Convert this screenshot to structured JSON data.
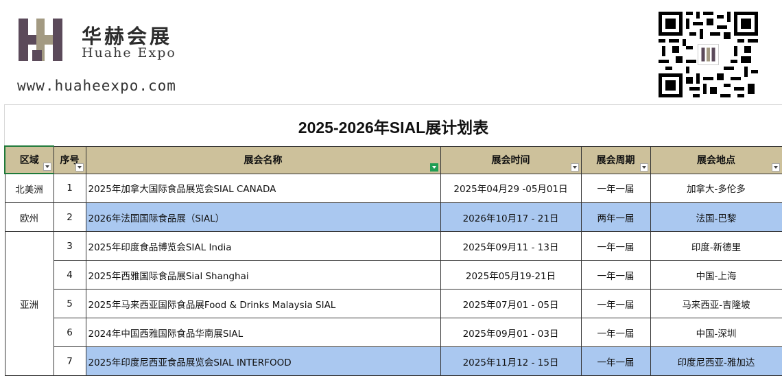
{
  "header": {
    "brand_cn": "华赫会展",
    "brand_en": "Huahe Expo",
    "website": "www.huaheexpo.com",
    "logo_color": "#5b4a5a",
    "logo_accent": "#a39a82"
  },
  "title": "2025-2026年SIAL展计划表",
  "table": {
    "columns": [
      "区域",
      "序号",
      "展会名称",
      "展会时间",
      "展会周期",
      "展会地点"
    ],
    "rows": [
      {
        "no": "1",
        "name": "2025年加拿大国际食品展览会SIAL CANADA",
        "date": "2025年04月29 -05月01日",
        "cycle": "一年一届",
        "location": "加拿大-多伦多",
        "highlight": false
      },
      {
        "no": "2",
        "name": "2026年法国国际食品展（SIAL）",
        "date": "2026年10月17 - 21日",
        "cycle": "两年一届",
        "location": "法国-巴黎",
        "highlight": true
      },
      {
        "no": "3",
        "name": "2025年印度食品博览会SIAL India",
        "date": "2025年09月11 - 13日",
        "cycle": "一年一届",
        "location": "印度-新德里",
        "highlight": false
      },
      {
        "no": "4",
        "name": "2025年西雅国际食品展Sial Shanghai",
        "date": "2025年05月19-21日",
        "cycle": "一年一届",
        "location": "中国-上海",
        "highlight": false
      },
      {
        "no": "5",
        "name": "2025年马来西亚国际食品展Food & Drinks Malaysia SIAL",
        "date": "2025年07月01 - 05日",
        "cycle": "一年一届",
        "location": "马来西亚-吉隆坡",
        "highlight": false
      },
      {
        "no": "6",
        "name": "2024年中国西雅国际食品华南展SIAL",
        "date": "2025年09月01 - 03日",
        "cycle": "一年一届",
        "location": "中国-深圳",
        "highlight": false
      },
      {
        "no": "7",
        "name": "2025年印度尼西亚食品展览会SIAL INTERFOOD",
        "date": "2025年11月12 - 15日",
        "cycle": "一年一届",
        "location": "印度尼西亚-雅加达",
        "highlight": true
      }
    ],
    "regions": {
      "north_america": "北美洲",
      "europe": "欧州",
      "asia": "亚洲"
    }
  },
  "colors": {
    "header_bg": "#cdc19b",
    "highlight_bg": "#aac8f0",
    "filter_active": "#1f9e54"
  }
}
